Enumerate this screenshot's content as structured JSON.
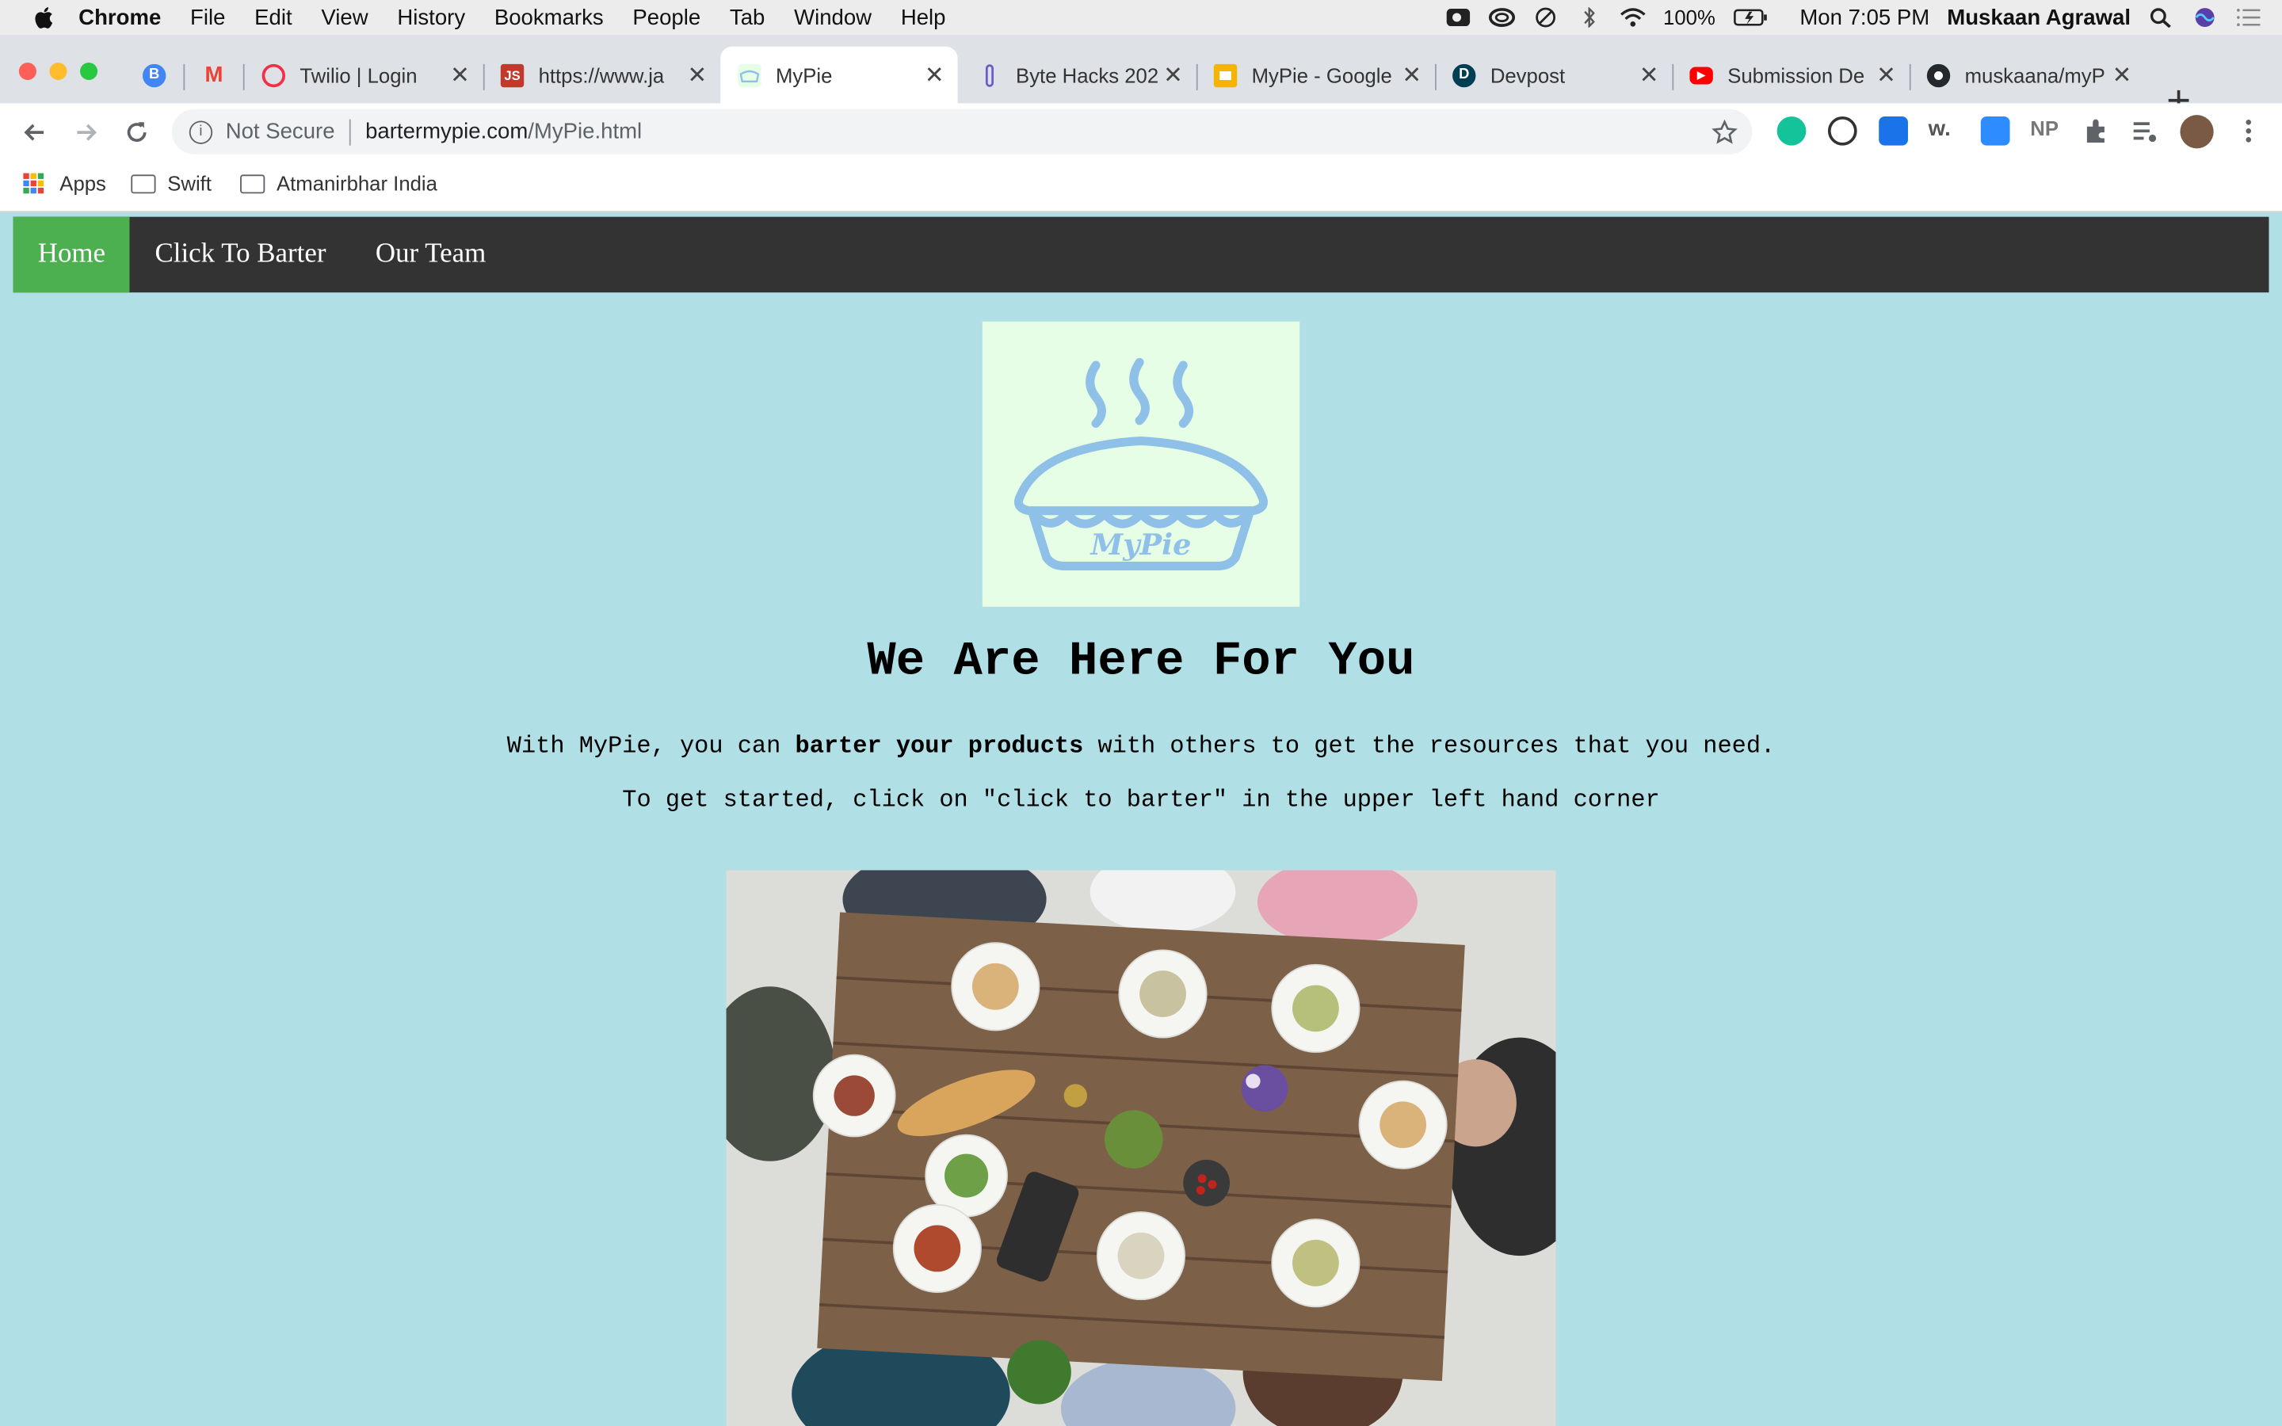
{
  "menubar": {
    "app_name": "Chrome",
    "items": [
      "File",
      "Edit",
      "View",
      "History",
      "Bookmarks",
      "People",
      "Tab",
      "Window",
      "Help"
    ],
    "battery": "100%",
    "clock": "Mon 7:05 PM",
    "user": "Muskaan Agrawal"
  },
  "tabs": [
    {
      "label": "",
      "favicon": "B",
      "color": "#4285f4"
    },
    {
      "label": "",
      "favicon": "M",
      "color": "#ea4335"
    },
    {
      "label": "Twilio | Login",
      "favicon": "twilio",
      "color": "#f22f46"
    },
    {
      "label": "https://www.ja",
      "favicon": "JS",
      "color": "#c0392b"
    },
    {
      "label": "MyPie",
      "favicon": "pie",
      "color": "#b8e0c0",
      "active": true
    },
    {
      "label": "Byte Hacks 202",
      "favicon": "bh",
      "color": "#6a5acd"
    },
    {
      "label": "MyPie - Google",
      "favicon": "slides",
      "color": "#f4b400"
    },
    {
      "label": "Devpost",
      "favicon": "D",
      "color": "#003e54"
    },
    {
      "label": "Submission De",
      "favicon": "yt",
      "color": "#ff0000"
    },
    {
      "label": "muskaana/myP",
      "favicon": "gh",
      "color": "#24292e"
    }
  ],
  "toolbar": {
    "security": "Not Secure",
    "url_host": "bartermypie.com",
    "url_path": "/MyPie.html"
  },
  "bookmarks": [
    "Apps",
    "Swift",
    "Atmanirbhar India"
  ],
  "page": {
    "nav": [
      "Home",
      "Click To Barter",
      "Our Team"
    ],
    "logo_text": "MyPie",
    "headline": "We Are Here For You",
    "para1_pre": "With MyPie, you can ",
    "para1_bold": "barter your products",
    "para1_post": " with others to get the resources that you need.",
    "para2": "To get started, click on \"click to barter\" in the upper left hand corner"
  },
  "colors": {
    "page_bg": "#b0dfe5",
    "nav_bg": "#333333",
    "nav_active": "#4caf50",
    "logo_bg": "#e6fde6",
    "logo_stroke": "#8fc0e8"
  }
}
